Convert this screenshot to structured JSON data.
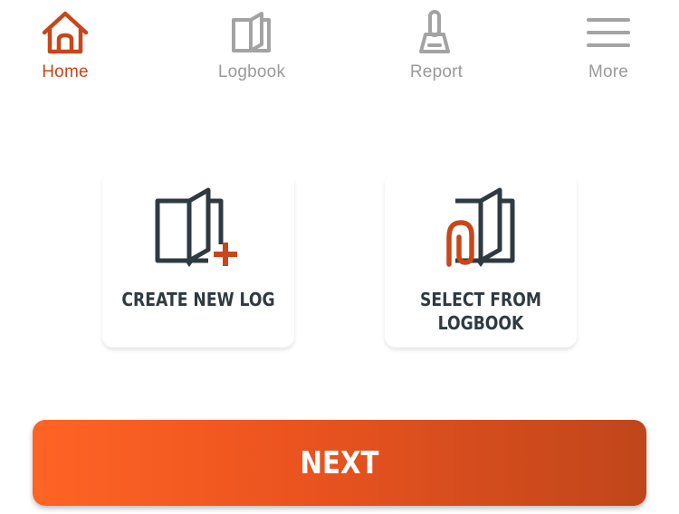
{
  "nav": {
    "items": [
      {
        "id": "home",
        "label": "Home",
        "icon": "home-icon",
        "active": true
      },
      {
        "id": "logbook",
        "label": "Logbook",
        "icon": "book-icon",
        "active": false
      },
      {
        "id": "report",
        "label": "Report",
        "icon": "report-icon",
        "active": false
      },
      {
        "id": "more",
        "label": "More",
        "icon": "menu-icon",
        "active": false
      }
    ]
  },
  "options": {
    "create_new_log": {
      "label": "CREATE NEW LOG",
      "icon": "book-plus-icon"
    },
    "select_from_logbook": {
      "label": "SELECT FROM LOGBOOK",
      "icon": "book-clip-icon"
    }
  },
  "next_button": {
    "label": "NEXT"
  },
  "colors": {
    "accent": "#c8461a",
    "inactive": "#9a9a9a",
    "icon_dark": "#2f3a40",
    "button_gradient_start": "#ff6424",
    "button_gradient_end": "#c0461b"
  }
}
